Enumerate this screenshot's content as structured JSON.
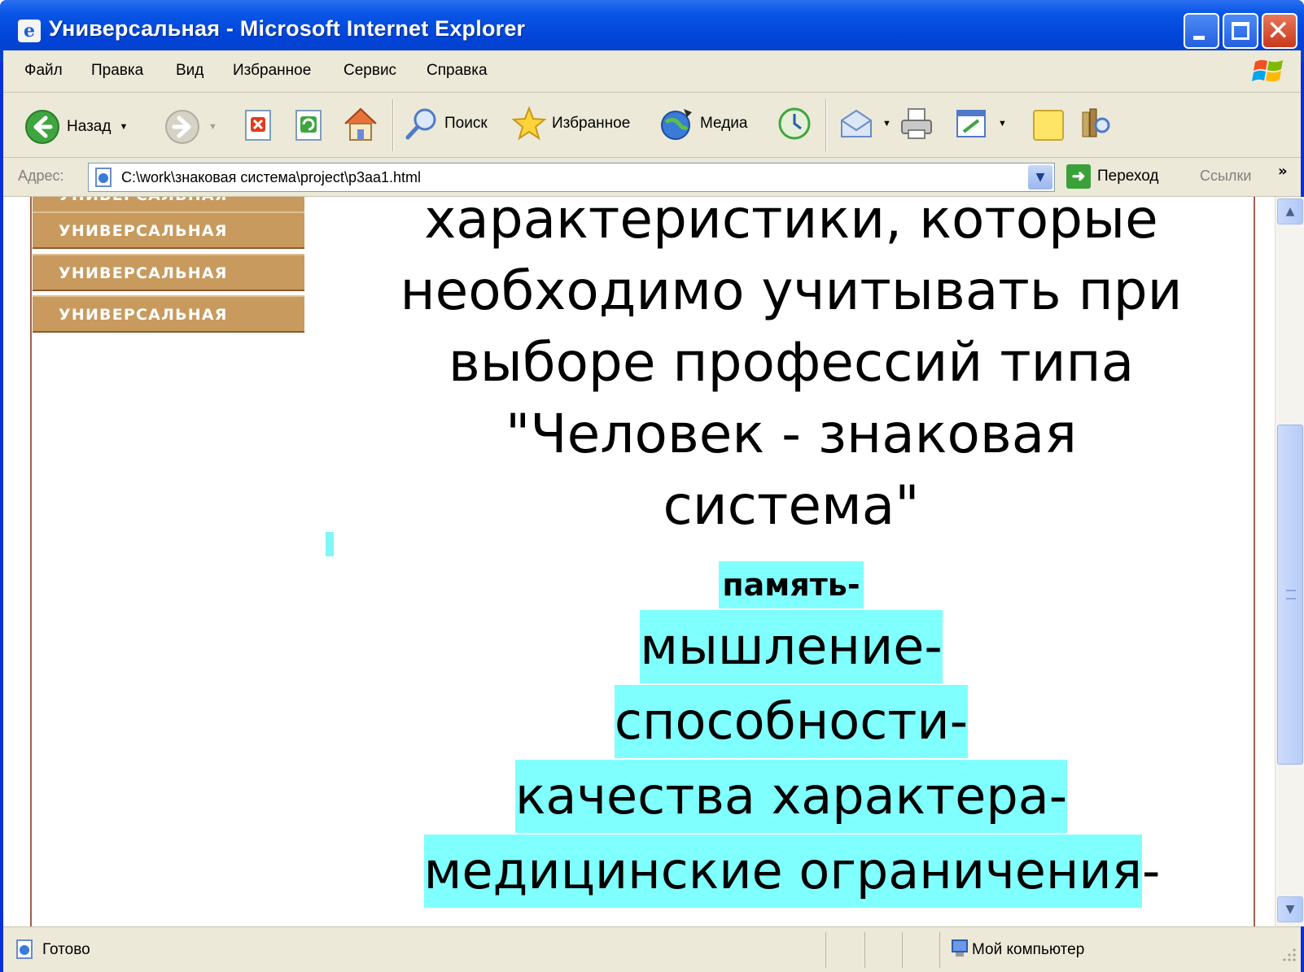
{
  "window": {
    "title": "Универсальная - Microsoft Internet Explorer"
  },
  "menubar": {
    "items": [
      "Файл",
      "Правка",
      "Вид",
      "Избранное",
      "Сервис",
      "Справка"
    ]
  },
  "toolbar": {
    "back_label": "Назад",
    "search_label": "Поиск",
    "favorites_label": "Избранное",
    "media_label": "Медиа"
  },
  "addressbar": {
    "label": "Адрес:",
    "url": "C:\\work\\знаковая система\\project\\p3aa1.html",
    "go_label": "Переход",
    "links_label": "Ссылки",
    "more_glyph": "»"
  },
  "sidebar": {
    "items": [
      "УНИВЕРСАЛЬНАЯ",
      "УНИВЕРСАЛЬНАЯ",
      "УНИВЕРСАЛЬНАЯ",
      "УНИВЕРСАЛЬНАЯ"
    ]
  },
  "content": {
    "heading_lines": [
      "характеристики, которые",
      "необходимо учитывать при",
      "выборе  профессий типа",
      "\"Человек - знаковая",
      "система\""
    ],
    "list": [
      {
        "text": "память-",
        "trail": ""
      },
      {
        "text": "мышление-",
        "trail": ""
      },
      {
        "text": "способности-",
        "trail": ""
      },
      {
        "text": "качества характера-",
        "trail": ""
      },
      {
        "text": "медицинские ограничения",
        "trail": "-"
      }
    ]
  },
  "statusbar": {
    "status": "Готово",
    "zone": "Мой компьютер"
  },
  "colors": {
    "highlight": "#80ffff",
    "nav_button": "#c89a5e",
    "titlebar": "#0a56e6"
  }
}
